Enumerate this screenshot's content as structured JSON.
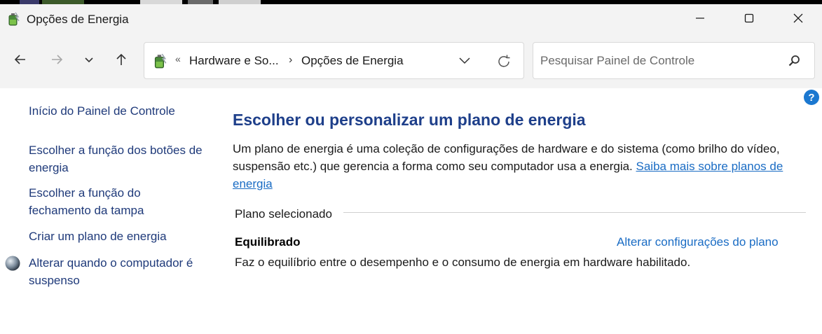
{
  "window": {
    "title": "Opções de Energia",
    "app_icon": "power-options-battery-icon"
  },
  "navigation": {
    "back_icon": "arrow-left-icon",
    "forward_icon": "arrow-right-icon",
    "recent_icon": "chevron-down-icon",
    "up_icon": "arrow-up-icon"
  },
  "address": {
    "overflow_chevron": "«",
    "breadcrumbs": [
      "Hardware e So...",
      "Opções de Energia"
    ],
    "separator": "›"
  },
  "search": {
    "placeholder": "Pesquisar Painel de Controle",
    "value": ""
  },
  "sidebar": {
    "home": "Início do Painel de Controle",
    "links": [
      "Escolher a função dos botões de energia",
      "Escolher a função do fechamento da tampa",
      "Criar um plano de energia",
      "Alterar quando o computador é suspenso"
    ]
  },
  "main": {
    "heading": "Escolher ou personalizar um plano de energia",
    "description": "Um plano de energia é uma coleção de configurações de hardware e do sistema (como brilho do vídeo, suspensão etc.) que gerencia a forma como seu computador usa a energia.",
    "learn_more_link": "Saiba mais sobre planos de energia",
    "section_label": "Plano selecionado",
    "plan": {
      "name": "Equilibrado",
      "change_link": "Alterar configurações do plano",
      "description": "Faz o equilíbrio entre o desempenho e o consumo de energia em hardware habilitado."
    }
  },
  "help": {
    "symbol": "?"
  },
  "colors": {
    "link": "#1a6cc4",
    "heading": "#1e3f8a",
    "sidebar_link": "#1f3a7a",
    "chrome_bg": "#f3f3f3"
  }
}
